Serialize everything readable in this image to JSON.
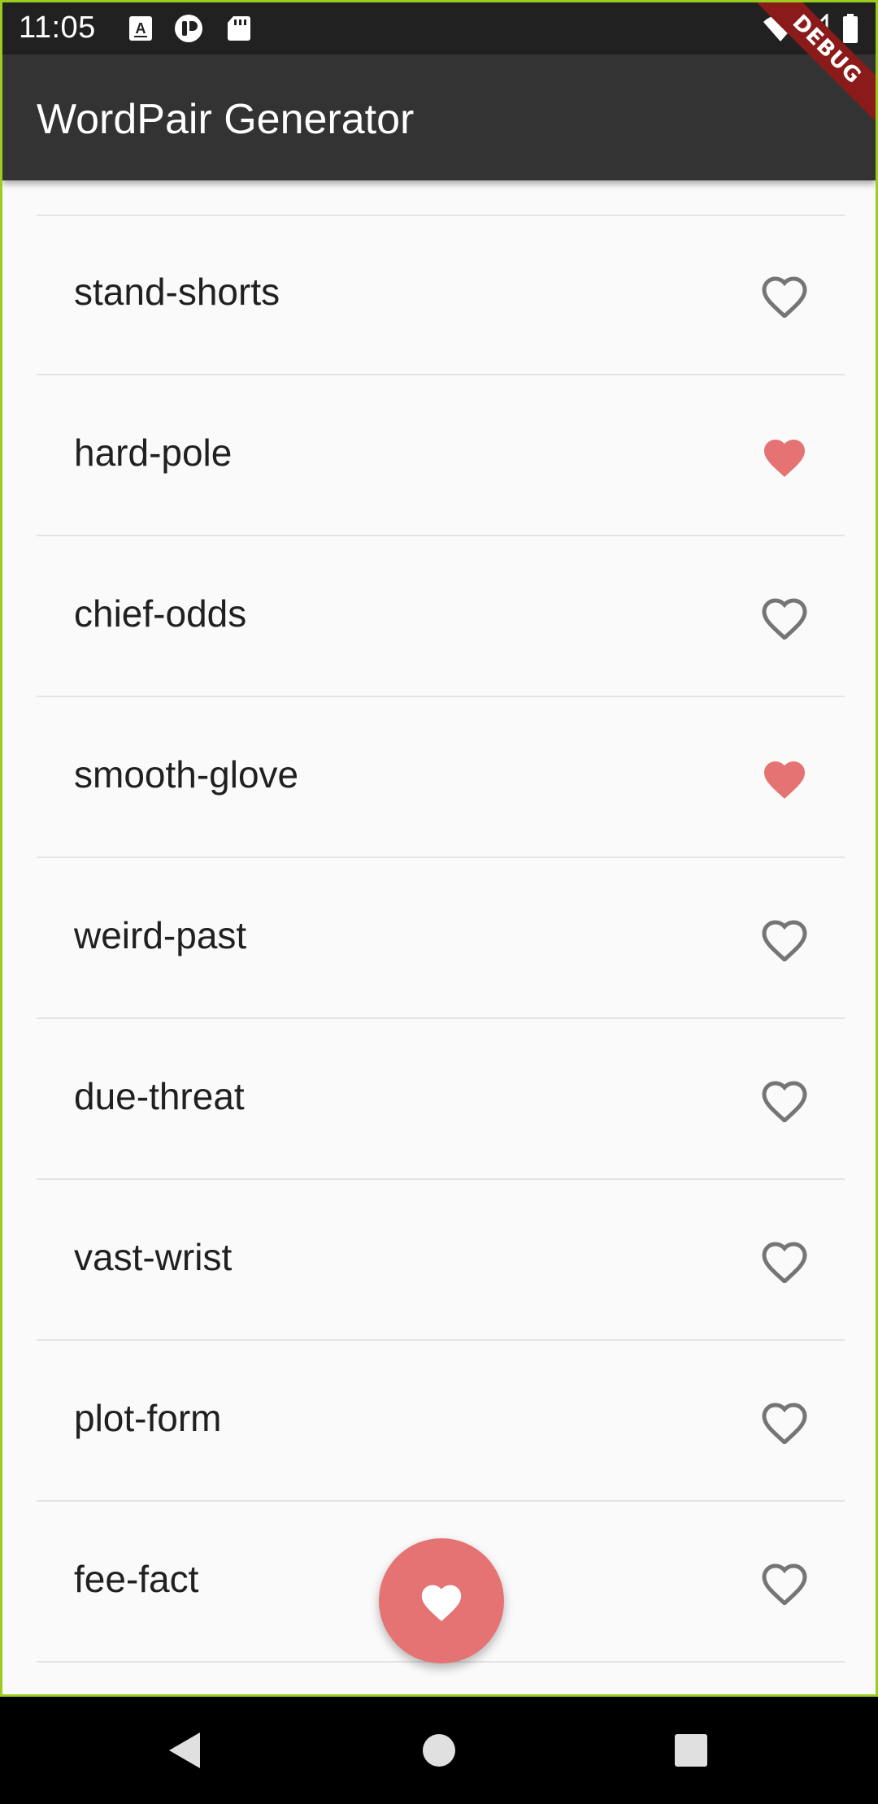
{
  "status_bar": {
    "time": "11:05",
    "notification_icons": [
      "font-icon",
      "sync-icon",
      "sd-card-icon"
    ],
    "right_icons": [
      "wifi-icon",
      "signal-icon",
      "battery-icon"
    ]
  },
  "app_bar": {
    "title": "WordPair Generator",
    "debug_label": "DEBUG"
  },
  "colors": {
    "favorite": "#e57373",
    "app_bar": "#333333",
    "status_bar": "#212121"
  },
  "list": {
    "items": [
      {
        "label": "stand-shorts",
        "favorite": false
      },
      {
        "label": "hard-pole",
        "favorite": true
      },
      {
        "label": "chief-odds",
        "favorite": false
      },
      {
        "label": "smooth-glove",
        "favorite": true
      },
      {
        "label": "weird-past",
        "favorite": false
      },
      {
        "label": "due-threat",
        "favorite": false
      },
      {
        "label": "vast-wrist",
        "favorite": false
      },
      {
        "label": "plot-form",
        "favorite": false
      },
      {
        "label": "fee-fact",
        "favorite": false
      }
    ]
  },
  "fab": {
    "icon": "heart-icon"
  },
  "nav_bar": {
    "buttons": [
      "back-icon",
      "home-icon",
      "recents-icon"
    ]
  }
}
